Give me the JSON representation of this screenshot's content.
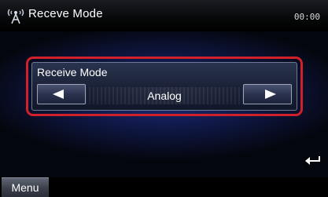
{
  "window": {
    "title": "Receve Mode",
    "clock": "00:00"
  },
  "setting": {
    "label": "Receive Mode",
    "value": "Analog",
    "prev_icon": "left-triangle-arrow",
    "next_icon": "right-triangle-arrow",
    "highlight_color": "#d0202a"
  },
  "footer": {
    "menu_label": "Menu",
    "back_icon": "return-arrow"
  }
}
